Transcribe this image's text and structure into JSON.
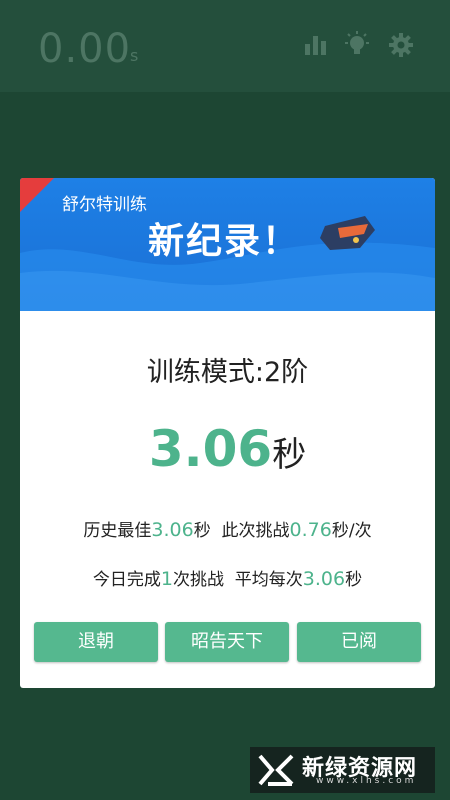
{
  "header": {
    "timer_value": "0.00",
    "timer_unit": "s",
    "icons": [
      "bar-chart-icon",
      "lightbulb-icon",
      "gear-icon"
    ]
  },
  "dialog": {
    "subtitle": "舒尔特训练",
    "title": "新纪录！",
    "mode_text": "训练模式:2阶",
    "result_value": "3.06",
    "result_unit": "秒",
    "stats": {
      "best_label": "历史最佳",
      "best_value": "3.06",
      "best_unit": "秒",
      "this_label": "此次挑战",
      "this_value": "0.76",
      "this_unit": "秒/次",
      "today_label": "今日完成",
      "today_value": "1",
      "today_unit": "次挑战",
      "avg_label": "平均每次",
      "avg_value": "3.06",
      "avg_unit": "秒"
    },
    "buttons": {
      "exit": "退朝",
      "share": "昭告天下",
      "read": "已阅"
    }
  },
  "watermark": {
    "name": "新绿资源网",
    "url": "www.xlhs.com"
  },
  "colors": {
    "accent_green": "#4db38c",
    "banner_blue": "#1a6fd4",
    "background": "#1f4a37"
  }
}
